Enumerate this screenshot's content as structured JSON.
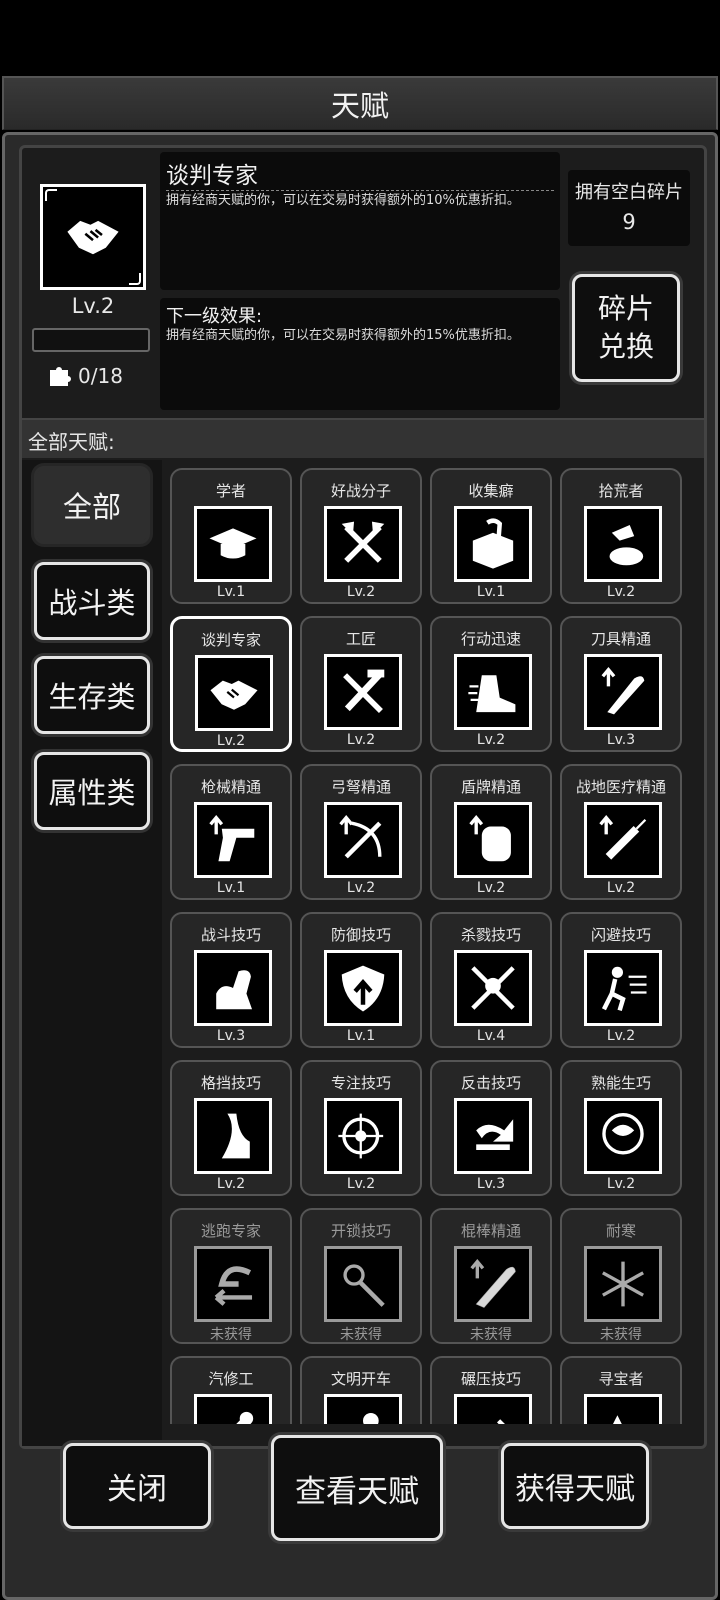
{
  "header": {
    "title": "天赋"
  },
  "selected": {
    "name": "谈判专家",
    "desc": "拥有经商天赋的你，可以在交易时获得额外的10%优惠折扣。",
    "next_label": "下一级效果:",
    "next_desc": "拥有经商天赋的你，可以在交易时获得额外的15%优惠折扣。",
    "level": "Lv.2",
    "progress_fraction": 0,
    "fragments": "0/18",
    "icon": "handshake-icon"
  },
  "blank_fragments": {
    "label": "拥有空白碎片",
    "count": "9"
  },
  "exchange_button": "碎片\n兑换",
  "all_talents_label": "全部天赋:",
  "categories": [
    "全部",
    "战斗类",
    "生存类",
    "属性类"
  ],
  "active_category": "全部",
  "talents": [
    {
      "name": "学者",
      "level": "Lv.1",
      "icon": "graduation-cap-icon"
    },
    {
      "name": "好战分子",
      "level": "Lv.2",
      "icon": "crossed-axes-icon"
    },
    {
      "name": "收集癖",
      "level": "Lv.1",
      "icon": "box-hand-icon"
    },
    {
      "name": "拾荒者",
      "level": "Lv.2",
      "icon": "scavenge-hand-icon"
    },
    {
      "name": "谈判专家",
      "level": "Lv.2",
      "icon": "handshake-icon"
    },
    {
      "name": "工匠",
      "level": "Lv.2",
      "icon": "hammer-saw-icon"
    },
    {
      "name": "行动迅速",
      "level": "Lv.2",
      "icon": "fast-boot-icon"
    },
    {
      "name": "刀具精通",
      "level": "Lv.3",
      "icon": "machete-icon"
    },
    {
      "name": "枪械精通",
      "level": "Lv.1",
      "icon": "pistol-icon"
    },
    {
      "name": "弓弩精通",
      "level": "Lv.2",
      "icon": "crossbow-icon"
    },
    {
      "name": "盾牌精通",
      "level": "Lv.2",
      "icon": "shield-icon"
    },
    {
      "name": "战地医疗精通",
      "level": "Lv.2",
      "icon": "syringe-icon"
    },
    {
      "name": "战斗技巧",
      "level": "Lv.3",
      "icon": "flexed-arm-icon"
    },
    {
      "name": "防御技巧",
      "level": "Lv.1",
      "icon": "shield-up-icon"
    },
    {
      "name": "杀戮技巧",
      "level": "Lv.4",
      "icon": "crossed-swords-icon"
    },
    {
      "name": "闪避技巧",
      "level": "Lv.2",
      "icon": "dodge-icon"
    },
    {
      "name": "格挡技巧",
      "level": "Lv.2",
      "icon": "parry-icon"
    },
    {
      "name": "专注技巧",
      "level": "Lv.2",
      "icon": "crosshair-icon"
    },
    {
      "name": "反击技巧",
      "level": "Lv.3",
      "icon": "counter-arm-icon"
    },
    {
      "name": "熟能生巧",
      "level": "Lv.2",
      "icon": "brain-icon"
    },
    {
      "name": "逃跑专家",
      "level": "未获得",
      "icon": "escape-arrow-icon"
    },
    {
      "name": "开锁技巧",
      "level": "未获得",
      "icon": "lockpick-icon"
    },
    {
      "name": "棍棒精通",
      "level": "未获得",
      "icon": "club-icon"
    },
    {
      "name": "耐寒",
      "level": "未获得",
      "icon": "snowflake-icon"
    },
    {
      "name": "汽修工",
      "level": "",
      "icon": "wrench-icon"
    },
    {
      "name": "文明开车",
      "level": "",
      "icon": "driver-icon"
    },
    {
      "name": "碾压技巧",
      "level": "",
      "icon": "speed-icon"
    },
    {
      "name": "寻宝者",
      "level": "",
      "icon": "treasure-icon"
    }
  ],
  "buttons": {
    "close": "关闭",
    "view": "查看天赋",
    "get": "获得天赋"
  }
}
